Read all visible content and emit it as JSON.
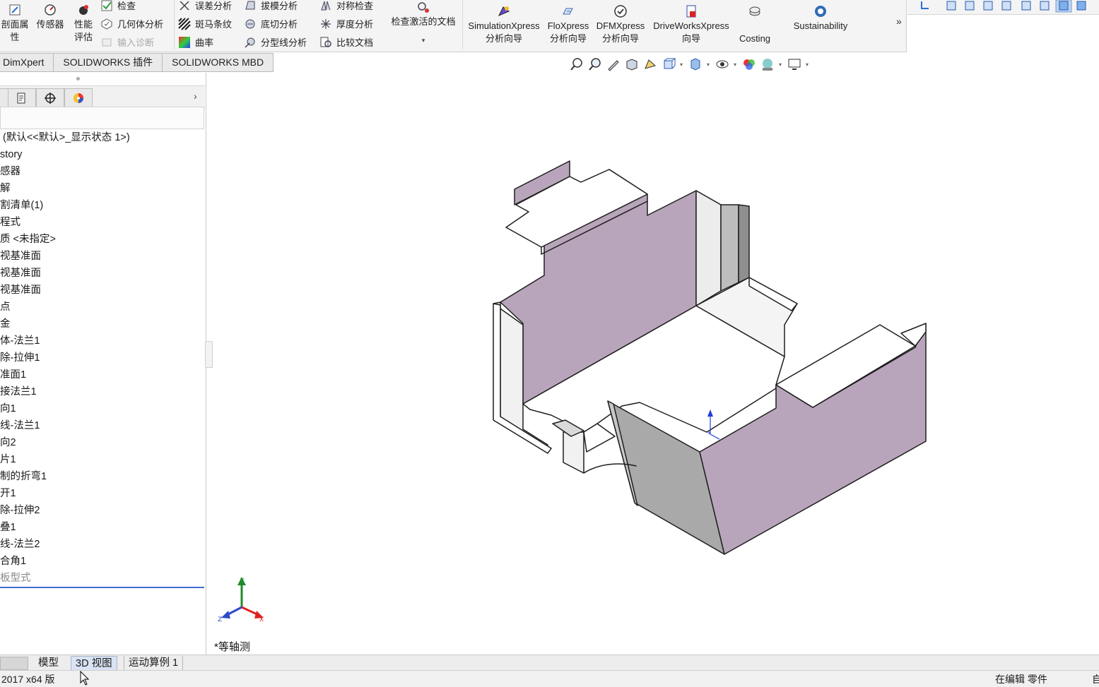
{
  "ribbon": {
    "col1": {
      "line1": "剖面属",
      "line2": "性"
    },
    "sensor": "传感器",
    "perf": {
      "line1": "性能",
      "line2": "评估"
    },
    "check": "检查",
    "geom_analysis": "几何体分析",
    "import_diag": "输入诊断",
    "deviation": "误差分析",
    "zebra": "斑马条纹",
    "curvature": "曲率",
    "draft": "拔模分析",
    "undercut": "底切分析",
    "parting": "分型线分析",
    "symmetry": "对称检查",
    "thickness": "厚度分析",
    "compare": "比较文档",
    "check_active": "检查激活的文档",
    "simx": {
      "line1": "SimulationXpress",
      "line2": "分析向导"
    },
    "flox": {
      "line1": "FloXpress",
      "line2": "分析向导"
    },
    "dfmx": {
      "line1": "DFMXpress",
      "line2": "分析向导"
    },
    "dwx": {
      "line1": "DriveWorksXpress",
      "line2": "向导"
    },
    "costing": "Costing",
    "sustainability": "Sustainability",
    "more": "»"
  },
  "tabs": [
    "DimXpert",
    "SOLIDWORKS 插件",
    "SOLIDWORKS MBD"
  ],
  "tree": [
    "(默认<<默认>_显示状态 1>)",
    "story",
    "感器",
    "解",
    "割清单(1)",
    "程式",
    "质 <未指定>",
    "视基准面",
    "视基准面",
    "视基准面",
    "点",
    "金",
    "体-法兰1",
    "除-拉伸1",
    "准面1",
    "接法兰1",
    "向1",
    "线-法兰1",
    "向2",
    "片1",
    "制的折弯1",
    "开1",
    "除-拉伸2",
    "叠1",
    "线-法兰2",
    "合角1",
    "板型式"
  ],
  "viewport": {
    "view_label": "*等轴测",
    "triad": {
      "x": "X",
      "y": "Y",
      "z": "Z"
    }
  },
  "sheet_tabs": [
    "模型",
    "3D 视图",
    "运动算例 1"
  ],
  "status": {
    "version": "2017 x64 版",
    "mode": "在编辑 零件",
    "right": "自"
  },
  "colors": {
    "face_purple": "#b9a5bb",
    "face_light": "#f2f2f2",
    "selection_blue": "#3d6fd1"
  }
}
